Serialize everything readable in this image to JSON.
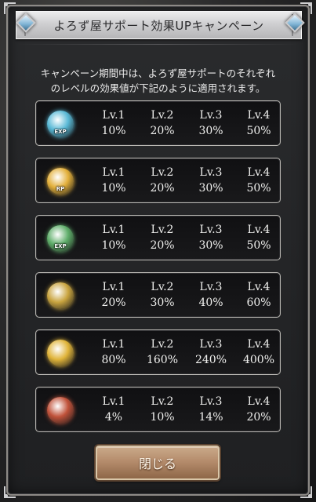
{
  "dialog": {
    "title": "よろず屋サポート効果UPキャンペーン",
    "description_lines": [
      "キャンペーン期間中は、よろず屋サポートのそれぞれ",
      "のレベルの効果値が下記のように適用されます。"
    ],
    "close_label": "閉じる"
  },
  "rows": [
    {
      "icon": "exp-icon",
      "icon_text": "EXP",
      "icon_color": "#59b9d6",
      "levels": [
        {
          "lv": "Lv.1",
          "value": "10%"
        },
        {
          "lv": "Lv.2",
          "value": "20%"
        },
        {
          "lv": "Lv.3",
          "value": "30%"
        },
        {
          "lv": "Lv.4",
          "value": "50%"
        }
      ]
    },
    {
      "icon": "rp-icon",
      "icon_text": "RP",
      "icon_color": "#e3b03b",
      "levels": [
        {
          "lv": "Lv.1",
          "value": "10%"
        },
        {
          "lv": "Lv.2",
          "value": "20%"
        },
        {
          "lv": "Lv.3",
          "value": "30%"
        },
        {
          "lv": "Lv.4",
          "value": "50%"
        }
      ]
    },
    {
      "icon": "weapon-exp-icon",
      "icon_text": "EXP",
      "icon_color": "#5fae6a",
      "levels": [
        {
          "lv": "Lv.1",
          "value": "10%"
        },
        {
          "lv": "Lv.2",
          "value": "20%"
        },
        {
          "lv": "Lv.3",
          "value": "30%"
        },
        {
          "lv": "Lv.4",
          "value": "50%"
        }
      ]
    },
    {
      "icon": "swords-icon",
      "icon_text": "",
      "icon_color": "#c9a43f",
      "levels": [
        {
          "lv": "Lv.1",
          "value": "20%"
        },
        {
          "lv": "Lv.2",
          "value": "30%"
        },
        {
          "lv": "Lv.3",
          "value": "40%"
        },
        {
          "lv": "Lv.4",
          "value": "60%"
        }
      ]
    },
    {
      "icon": "coins-icon",
      "icon_text": "",
      "icon_color": "#e0b43a",
      "levels": [
        {
          "lv": "Lv.1",
          "value": "80%"
        },
        {
          "lv": "Lv.2",
          "value": "160%"
        },
        {
          "lv": "Lv.3",
          "value": "240%"
        },
        {
          "lv": "Lv.4",
          "value": "400%"
        }
      ]
    },
    {
      "icon": "treasure-chest-icon",
      "icon_text": "",
      "icon_color": "#c0523a",
      "levels": [
        {
          "lv": "Lv.1",
          "value": "4%"
        },
        {
          "lv": "Lv.2",
          "value": "10%"
        },
        {
          "lv": "Lv.3",
          "value": "14%"
        },
        {
          "lv": "Lv.4",
          "value": "20%"
        }
      ]
    }
  ]
}
